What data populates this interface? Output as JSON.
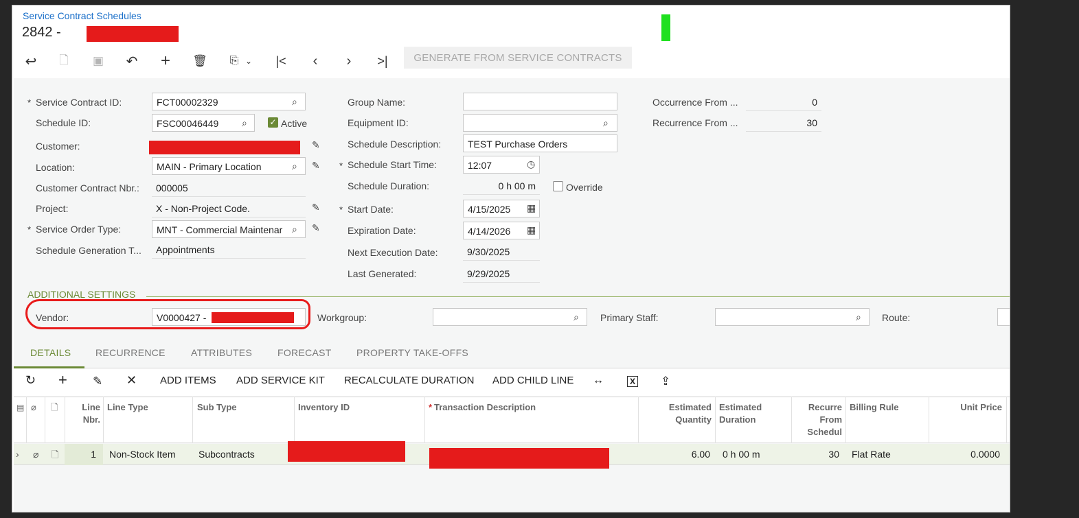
{
  "header": {
    "breadcrumb": "Service Contract Schedules",
    "title_prefix": "2842 -"
  },
  "toolbar": {
    "generate_label": "GENERATE FROM SERVICE CONTRACTS"
  },
  "form": {
    "service_contract_id": {
      "label": "Service Contract ID:",
      "value": "FCT00002329"
    },
    "schedule_id": {
      "label": "Schedule ID:",
      "value": "FSC00046449"
    },
    "active": {
      "label": "Active",
      "checked": true
    },
    "customer": {
      "label": "Customer:"
    },
    "location": {
      "label": "Location:",
      "value": "MAIN - Primary Location"
    },
    "customer_contract_nbr": {
      "label": "Customer Contract Nbr.:",
      "value": "000005"
    },
    "project": {
      "label": "Project:",
      "value": "X - Non-Project Code."
    },
    "service_order_type": {
      "label": "Service Order Type:",
      "value": "MNT - Commercial Maintenar"
    },
    "schedule_generation_type": {
      "label": "Schedule Generation T...",
      "value": "Appointments"
    },
    "group_name": {
      "label": "Group Name:",
      "value": ""
    },
    "equipment_id": {
      "label": "Equipment ID:",
      "value": ""
    },
    "schedule_description": {
      "label": "Schedule Description:",
      "value": "TEST Purchase Orders"
    },
    "schedule_start_time": {
      "label": "Schedule Start Time:",
      "value": "12:07"
    },
    "schedule_duration": {
      "label": "Schedule Duration:",
      "value": "0 h 00 m"
    },
    "override": {
      "label": "Override",
      "checked": false
    },
    "start_date": {
      "label": "Start Date:",
      "value": "4/15/2025"
    },
    "expiration_date": {
      "label": "Expiration Date:",
      "value": "4/14/2026"
    },
    "next_execution_date": {
      "label": "Next Execution Date:",
      "value": "9/30/2025"
    },
    "last_generated": {
      "label": "Last Generated:",
      "value": "9/29/2025"
    },
    "occurrence_from": {
      "label": "Occurrence From ...",
      "value": "0"
    },
    "recurrence_from": {
      "label": "Recurrence From ...",
      "value": "30"
    }
  },
  "additional": {
    "section_title": "ADDITIONAL SETTINGS",
    "vendor": {
      "label": "Vendor:",
      "value_prefix": "V0000427 -"
    },
    "workgroup": {
      "label": "Workgroup:",
      "value": ""
    },
    "primary_staff": {
      "label": "Primary Staff:",
      "value": ""
    },
    "route": {
      "label": "Route:"
    }
  },
  "tabs": [
    "DETAILS",
    "RECURRENCE",
    "ATTRIBUTES",
    "FORECAST",
    "PROPERTY TAKE-OFFS"
  ],
  "grid_toolbar": {
    "add_items": "ADD ITEMS",
    "add_service_kit": "ADD SERVICE KIT",
    "recalculate_duration": "RECALCULATE DURATION",
    "add_child_line": "ADD CHILD LINE"
  },
  "grid": {
    "columns": {
      "line_nbr_1": "Line",
      "line_nbr_2": "Nbr.",
      "line_type": "Line Type",
      "sub_type": "Sub Type",
      "inventory_id": "Inventory ID",
      "transaction_description": "Transaction Description",
      "est_qty_1": "Estimated",
      "est_qty_2": "Quantity",
      "est_dur_1": "Estimated",
      "est_dur_2": "Duration",
      "recurre_1": "Recurre",
      "recurre_2": "From",
      "recurre_3": "Schedul",
      "billing_rule": "Billing Rule",
      "unit_price": "Unit Price"
    },
    "rows": [
      {
        "line_nbr": "1",
        "line_type": "Non-Stock Item",
        "sub_type": "Subcontracts",
        "est_qty": "6.00",
        "est_dur": "0 h 00 m",
        "recurre": "30",
        "billing_rule": "Flat Rate",
        "unit_price": "0.0000"
      }
    ]
  },
  "colors": {
    "accent": "#6b8a36",
    "link": "#1a6fc9",
    "redaction": "#e51b1b",
    "annotation": "#e81b1b"
  }
}
